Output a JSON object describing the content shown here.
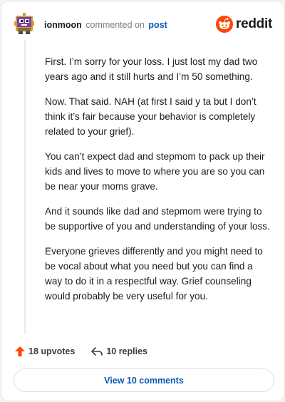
{
  "header": {
    "username": "ionmoon",
    "action_text": "commented on",
    "post_link": "post",
    "brand_wordmark": "reddit",
    "brand_color": "#ff4500"
  },
  "comment": {
    "paragraphs": [
      "First. I’m sorry for your loss. I just lost my dad two years ago and it still hurts and I’m 50 something.",
      "Now. That said. NAH (at first I said y ta but I don’t think it’s fair because your behavior is completely related to your grief).",
      "You can’t expect dad and stepmom to pack up their kids and lives to move to where you are so you can be near your moms grave.",
      "And it sounds like dad and stepmom were trying to be supportive of you and understanding of your loss.",
      "Everyone grieves differently and you might need to be vocal about what you need but you can find a way to do it in a respectful way. Grief counseling would probably be very useful for you."
    ]
  },
  "actions": {
    "upvotes_label": "18 upvotes",
    "replies_label": "10 replies",
    "view_comments_label": "View 10 comments"
  },
  "icons": {
    "avatar": "snoo-avatar-icon",
    "brand": "reddit-logo-icon",
    "upvote": "upvote-arrow-icon",
    "reply": "reply-arrow-icon"
  }
}
